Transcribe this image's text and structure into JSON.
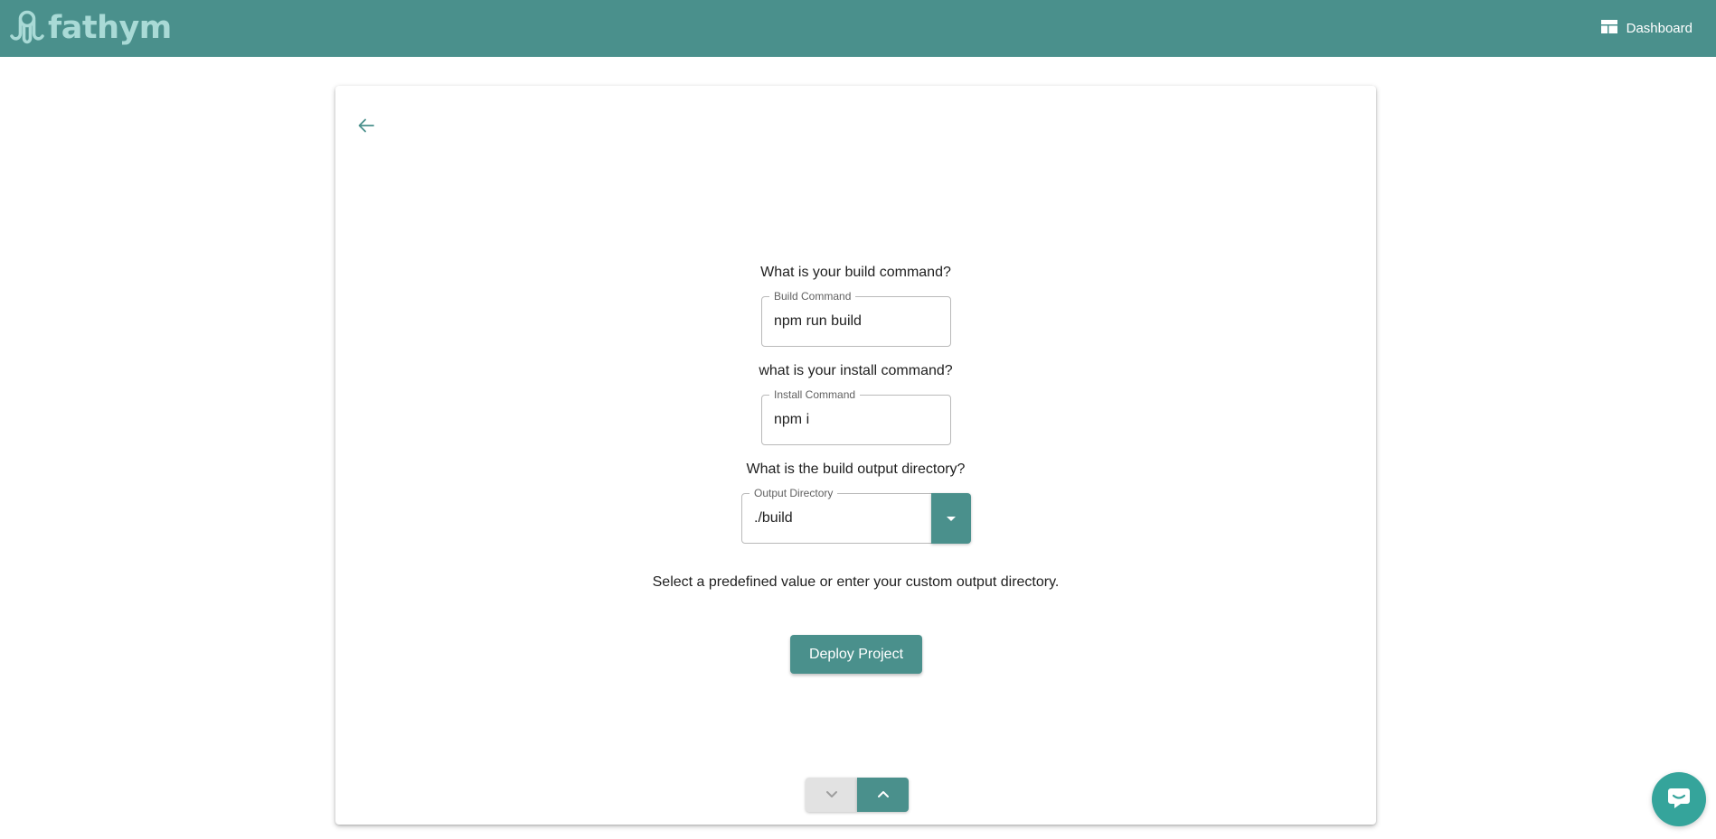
{
  "brand": {
    "name": "fathym",
    "icon": "octopus-logo-icon",
    "color": "#a9dad6"
  },
  "header": {
    "background": "#4a908c",
    "dashboard_label": "Dashboard",
    "dashboard_icon": "dashboard-icon"
  },
  "form": {
    "back_icon": "arrow-left-icon",
    "build": {
      "question": "What is your build command?",
      "label": "Build Command",
      "value": "npm run build"
    },
    "install": {
      "question": "what is your install command?",
      "label": "Install Command",
      "value": "npm i"
    },
    "output": {
      "question": "What is the build output directory?",
      "label": "Output Directory",
      "value": "./build",
      "dropdown_icon": "caret-down-icon"
    },
    "hint": "Select a predefined value or enter your custom output directory.",
    "deploy_label": "Deploy Project"
  },
  "stepper": {
    "down_icon": "chevron-down-icon",
    "up_icon": "chevron-up-icon"
  },
  "chat": {
    "icon": "chat-icon",
    "color": "#35a49b"
  }
}
